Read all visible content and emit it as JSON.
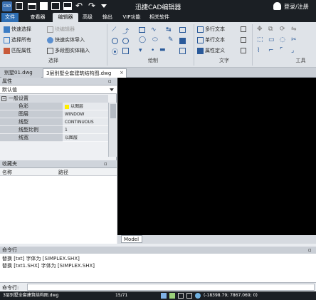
{
  "titlebar": {
    "title": "迅捷CAD编辑器",
    "login": "登录/注册"
  },
  "tabs": [
    "文件",
    "查看器",
    "编辑器",
    "高级",
    "输出",
    "VIP功能",
    "相关软件"
  ],
  "ribbon": {
    "select": {
      "quick_select": "快速选择",
      "select_all": "选择所有",
      "match_props": "匹配属性",
      "block_edit": "块编辑器",
      "quick_block_import": "快速实体导入",
      "multi_block_import": "多段图实体输入",
      "group": "选择"
    },
    "draw": {
      "group": "绘制"
    },
    "text": {
      "mtext": "多行文本",
      "stext": "单行文本",
      "attdef": "属性定义",
      "group": "文字"
    },
    "tools": {
      "group": "工具"
    }
  },
  "doctabs": [
    "别墅01.dwg",
    "3层别墅全套建筑结构图.dwg"
  ],
  "props": {
    "header": "属性",
    "dropdown": "默认值",
    "section": "一般设置",
    "rows": [
      {
        "k": "色彩",
        "v": "以图层"
      },
      {
        "k": "图层",
        "v": "WINDOW"
      },
      {
        "k": "线型",
        "v": "CONTINUOUS"
      },
      {
        "k": "线型比例",
        "v": "1"
      },
      {
        "k": "线宽",
        "v": "以图层"
      }
    ]
  },
  "favorites": {
    "header": "收藏夹",
    "col_name": "名称",
    "col_path": "路径"
  },
  "model_tab": "Model",
  "command": {
    "header": "命令行",
    "lines": [
      "替换 [txt] 字体为 [SIMPLEX.SHX]",
      "替换 [txt1.SHX] 字体为 [SIMPLEX.SHX]"
    ],
    "prompt": "命令行:"
  },
  "status": {
    "file": "3层别墅全套建筑结构图.dwg",
    "pages": "15/71",
    "coords": "(-18398.79; 7867.069; 0)"
  }
}
